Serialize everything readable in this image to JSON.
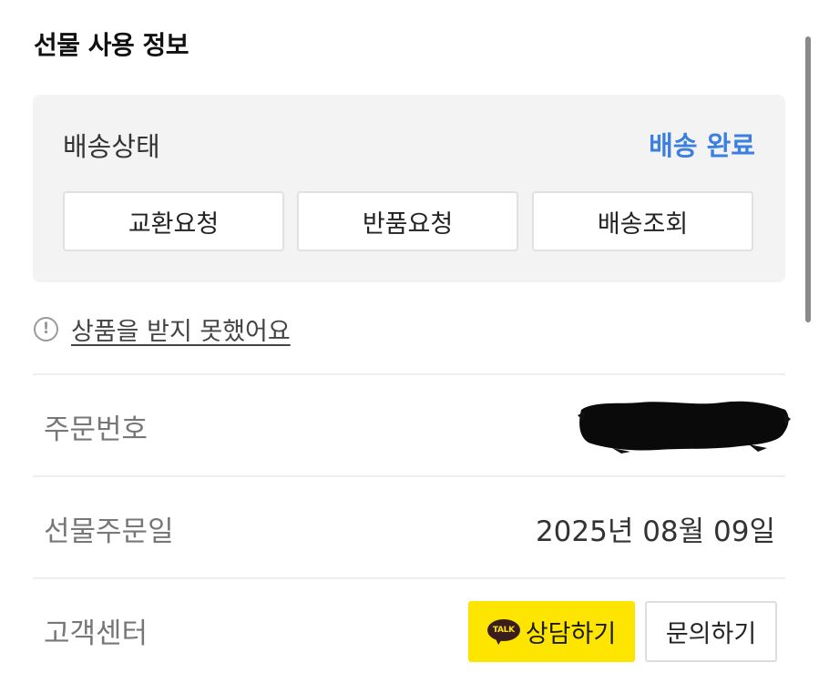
{
  "section": {
    "title": "선물 사용 정보"
  },
  "delivery": {
    "status_label": "배송상태",
    "status_value": "배송 완료",
    "status_color": "#3b7fe0",
    "actions": {
      "exchange": "교환요청",
      "return": "반품요청",
      "track": "배송조회"
    }
  },
  "notice": {
    "icon": "info-circle-icon",
    "text": "상품을 받지 못했어요"
  },
  "order_info": {
    "order_number_label": "주문번호",
    "order_number_value": "",
    "order_number_redacted": true,
    "order_date_label": "선물주문일",
    "order_date_value": "2025년 08월 09일"
  },
  "customer_center": {
    "label": "고객센터",
    "kakao_badge": "TALK",
    "kakao_button": "상담하기",
    "kakao_color": "#fee500",
    "inquiry_button": "문의하기"
  }
}
